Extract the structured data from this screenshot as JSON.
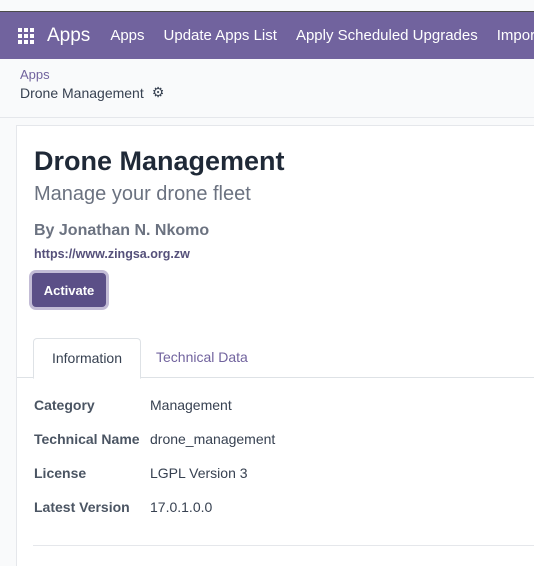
{
  "navbar": {
    "brand": "Apps",
    "menu": [
      "Apps",
      "Update Apps List",
      "Apply Scheduled Upgrades",
      "Import Mo"
    ]
  },
  "breadcrumb": {
    "parent": "Apps",
    "current": "Drone Management"
  },
  "app": {
    "title": "Drone Management",
    "subtitle": "Manage your drone fleet",
    "author": "By Jonathan N. Nkomo",
    "website": "https://www.zingsa.org.zw",
    "activate_label": "Activate"
  },
  "tabs": [
    "Information",
    "Technical Data"
  ],
  "fields": [
    {
      "label": "Category",
      "value": "Management"
    },
    {
      "label": "Technical Name",
      "value": "drone_management"
    },
    {
      "label": "License",
      "value": "LGPL Version 3"
    },
    {
      "label": "Latest Version",
      "value": "17.0.1.0.0"
    }
  ],
  "icons": {
    "apps_menu": "apps-grid-icon",
    "settings": "gear-icon"
  },
  "colors": {
    "navbar": "#71639e",
    "primary_button": "#5b4f87",
    "link": "#71639e"
  }
}
